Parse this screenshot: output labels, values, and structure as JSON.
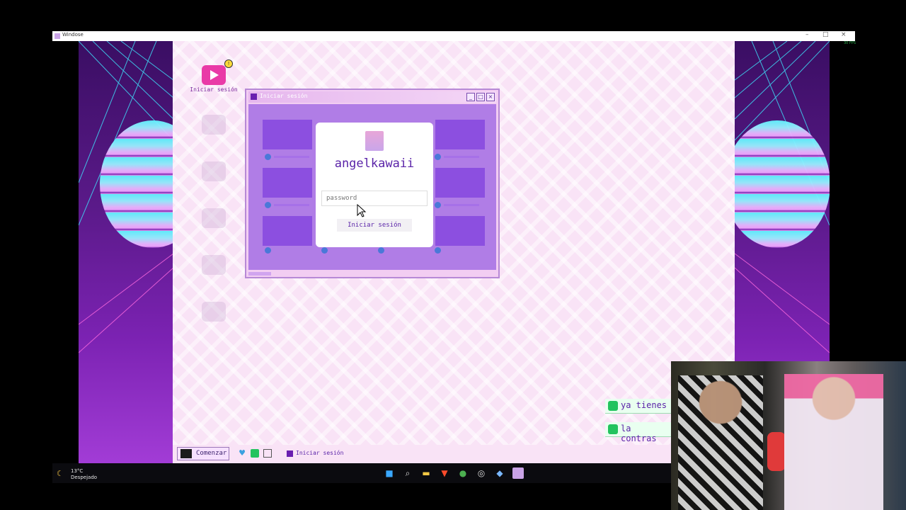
{
  "host_window": {
    "title": "Windose",
    "controls": [
      "–",
      "□",
      "×"
    ],
    "fps_label": "30 FPS"
  },
  "desktop": {
    "icons": [
      {
        "label": "Iniciar sesión",
        "badge": "!"
      }
    ]
  },
  "login_window": {
    "title": "Iniciar sesión",
    "username": "angelkawaii",
    "password_placeholder": "password",
    "login_button": "Iniciar sesión"
  },
  "inner_taskbar": {
    "start_label": "Comenzar",
    "task_label": "Iniciar sesión"
  },
  "chat": [
    {
      "text": "ya tienes"
    },
    {
      "text": "la contras"
    }
  ],
  "host_taskbar": {
    "weather_temp": "13°C",
    "weather_desc": "Despejado",
    "icons": [
      "windows-start-icon",
      "search-icon",
      "folder-icon",
      "brave-icon",
      "chrome-icon",
      "obs-icon",
      "steam-icon",
      "windose-icon"
    ]
  },
  "colors": {
    "accent": "#5a23a8",
    "desktop_bg": "#f9e3f6",
    "window_body": "#b07de6"
  }
}
